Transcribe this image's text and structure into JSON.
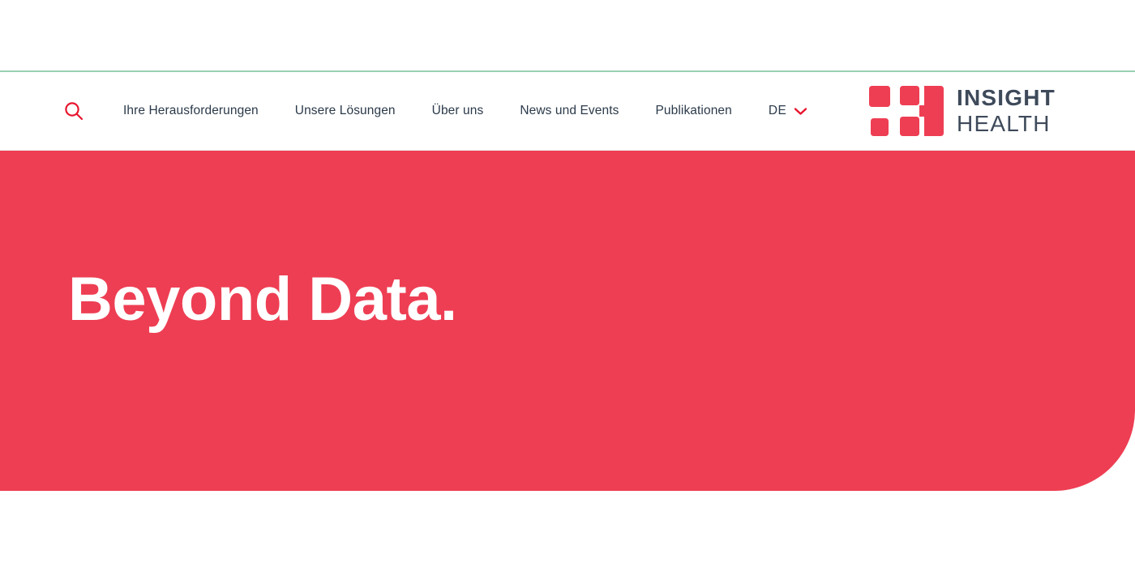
{
  "site": {
    "brand_name_line1": "INSIGHT",
    "brand_name_line2": "HEALTH",
    "accent_color": "#ee3e53",
    "accent_rule_color": "#9ad0b4",
    "text_color": "#2b3a4a",
    "logo_text_color": "#3e4a5a"
  },
  "header": {
    "search_icon": "search-icon",
    "nav_items": [
      {
        "label": "Ihre Herausforderungen"
      },
      {
        "label": "Unsere Lösungen"
      },
      {
        "label": "Über uns"
      },
      {
        "label": "News und Events"
      },
      {
        "label": "Publikationen"
      }
    ],
    "language": {
      "label": "DE",
      "chevron_icon": "chevron-down-icon"
    }
  },
  "hero": {
    "title": "Beyond Data.",
    "background_color": "#ee3e53",
    "title_color": "#ffffff"
  }
}
